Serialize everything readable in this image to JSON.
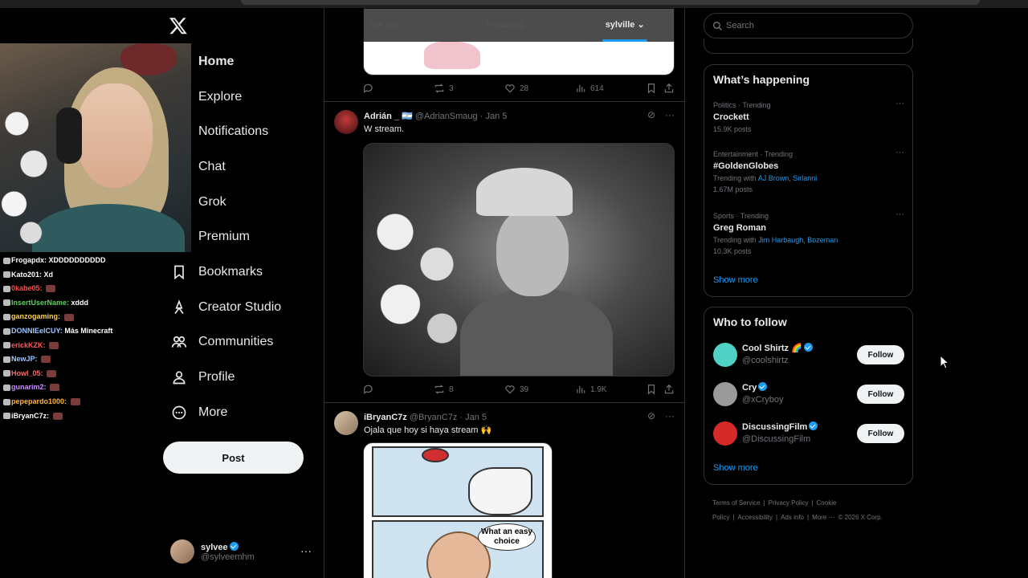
{
  "stream": {
    "chat": [
      {
        "user": "Frogapdx:",
        "msg": "XDDDDDDDDDD",
        "color": "#ffffff"
      },
      {
        "user": "Kato201:",
        "msg": "Xd",
        "color": "#ffffff"
      },
      {
        "user": "0kabe05:",
        "msg": "",
        "color": "#ff4d4d"
      },
      {
        "user": "InsertUserName:",
        "msg": "xddd",
        "color": "#5bd15b"
      },
      {
        "user": "ganzogaming:",
        "msg": "",
        "color": "#ffd24d"
      },
      {
        "user": "DONNIEelCUY:",
        "msg": "Más Minecraft",
        "color": "#9ec7ff"
      },
      {
        "user": "erickKZK:",
        "msg": "",
        "color": "#ff5a5a"
      },
      {
        "user": "NewJP:",
        "msg": "",
        "color": "#9ec7ff"
      },
      {
        "user": "Howl_05:",
        "msg": "",
        "color": "#ff6a6a"
      },
      {
        "user": "gunarim2:",
        "msg": "",
        "color": "#c98bff"
      },
      {
        "user": "pepepardo1000:",
        "msg": "",
        "color": "#ffb347"
      },
      {
        "user": "iBryanC7z:",
        "msg": "",
        "color": "#ffffff"
      }
    ]
  },
  "nav": {
    "items": [
      {
        "label": "Home",
        "icon": "home-icon"
      },
      {
        "label": "Explore",
        "icon": "search-icon"
      },
      {
        "label": "Notifications",
        "icon": "bell-icon"
      },
      {
        "label": "Chat",
        "icon": "mail-icon"
      },
      {
        "label": "Grok",
        "icon": "grok-icon"
      },
      {
        "label": "Premium",
        "icon": "x-icon"
      },
      {
        "label": "Bookmarks",
        "icon": "bookmark-icon"
      },
      {
        "label": "Creator Studio",
        "icon": "creator-icon"
      },
      {
        "label": "Communities",
        "icon": "people-icon"
      },
      {
        "label": "Profile",
        "icon": "person-icon"
      },
      {
        "label": "More",
        "icon": "more-circle-icon"
      }
    ],
    "post_label": "Post",
    "account": {
      "name": "sylvee",
      "handle": "@sylveemhm"
    }
  },
  "feed": {
    "tabs": [
      "For you",
      "Following",
      "sylville"
    ],
    "prev_stats": {
      "replies": "",
      "reposts": "3",
      "likes": "28",
      "views": "614"
    },
    "tweets": [
      {
        "name": "Adrián _",
        "handle": "@AdrianSmaug",
        "date": "· Jan 5",
        "text": "W stream.",
        "stats": {
          "replies": "",
          "reposts": "8",
          "likes": "39",
          "views": "1.9K"
        }
      },
      {
        "name": "iBryanC7z",
        "handle": "@BryanC7z",
        "date": "· Jan 5",
        "text": "Ojala que hoy si haya stream 🙌",
        "meme_text": "What an easy choice"
      }
    ]
  },
  "right": {
    "search_placeholder": "Search",
    "happening": {
      "title": "What’s happening",
      "trends": [
        {
          "category": "Politics · Trending",
          "title": "Crockett",
          "with_label": "",
          "with_links": "",
          "count": "15.9K posts"
        },
        {
          "category": "Entertainment · Trending",
          "title": "#GoldenGlobes",
          "with_label": "Trending with",
          "with_links": "AJ Brown, Sirlanni",
          "count": "1.67M posts"
        },
        {
          "category": "Sports · Trending",
          "title": "Greg Roman",
          "with_label": "Trending with",
          "with_links": "Jim Harbaugh, Bozeman",
          "count": "10.3K posts"
        }
      ],
      "show_more": "Show more"
    },
    "who_to_follow": {
      "title": "Who to follow",
      "accounts": [
        {
          "name": "Cool Shirtz 🌈",
          "handle": "@coolshirtz",
          "button": "Follow",
          "color": "#4fd1c5"
        },
        {
          "name": "Cry",
          "handle": "@xCryboy",
          "button": "Follow",
          "color": "#9a9a9a"
        },
        {
          "name": "DiscussingFilm",
          "handle": "@DiscussingFilm",
          "button": "Follow",
          "color": "#d62a2a"
        }
      ],
      "show_more": "Show more"
    },
    "footer": [
      "Terms of Service",
      "|",
      "Privacy Policy",
      "|",
      "Cookie Policy",
      "|",
      "Accessibility",
      "|",
      "Ads info",
      "|",
      "More ···",
      "© 2026 X Corp."
    ]
  },
  "colors": {
    "accent": "#1d9bf0",
    "bg": "#000000",
    "border": "#2f3336",
    "muted": "#71767b"
  }
}
